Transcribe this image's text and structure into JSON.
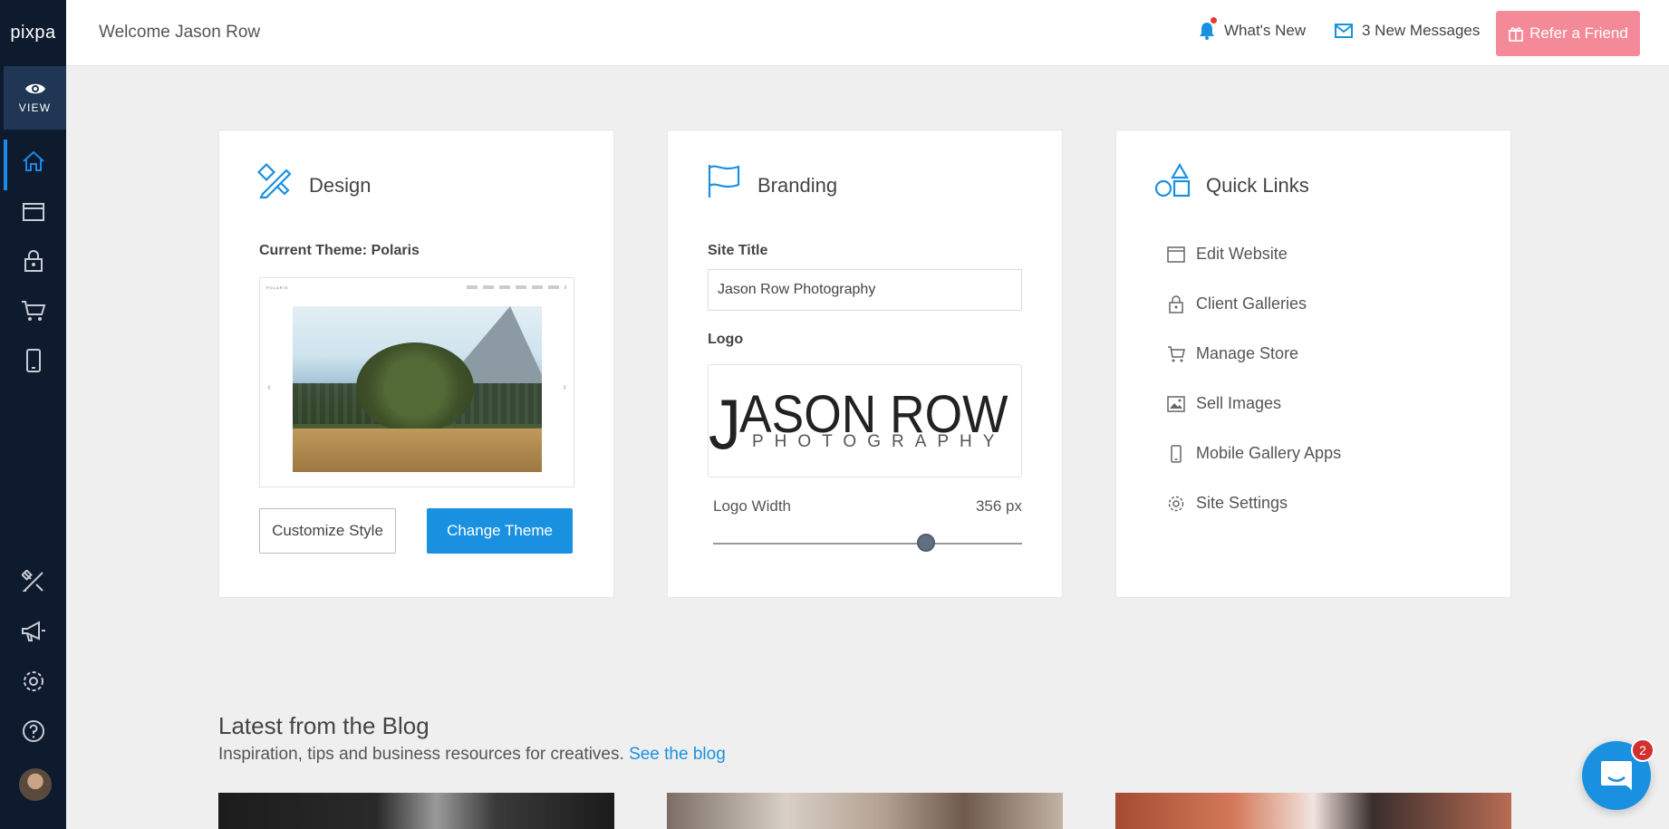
{
  "sidebar": {
    "logo": "pixpa",
    "view_label": "VIEW",
    "top_icons": [
      "home-icon",
      "website-icon",
      "lock-icon",
      "cart-icon",
      "mobile-icon"
    ],
    "bottom_icons": [
      "design-tools-icon",
      "megaphone-icon",
      "gear-icon",
      "help-icon"
    ]
  },
  "header": {
    "welcome": "Welcome Jason Row",
    "whats_new": "What's New",
    "messages": "3 New Messages",
    "refer": "Refer a Friend"
  },
  "design": {
    "title": "Design",
    "current_theme": "Current Theme: Polaris",
    "preview_brand": "POLARIS",
    "customize_label": "Customize Style",
    "change_label": "Change Theme"
  },
  "branding": {
    "title": "Branding",
    "site_title_label": "Site Title",
    "site_title_value": "Jason Row Photography",
    "logo_label": "Logo",
    "logo_main": "JASON ROW",
    "logo_sub": "PHOTOGRAPHY",
    "logo_width_label": "Logo Width",
    "logo_width_value": "356 px",
    "logo_width_level": 0.69
  },
  "quick_links": {
    "title": "Quick Links",
    "items": [
      {
        "label": "Edit Website",
        "icon": "browser-icon"
      },
      {
        "label": "Client Galleries",
        "icon": "lock-icon"
      },
      {
        "label": "Manage Store",
        "icon": "cart-icon"
      },
      {
        "label": "Sell Images",
        "icon": "image-icon"
      },
      {
        "label": "Mobile Gallery Apps",
        "icon": "mobile-icon"
      },
      {
        "label": "Site Settings",
        "icon": "gear-icon"
      }
    ]
  },
  "blog": {
    "title": "Latest from the Blog",
    "subtitle": "Inspiration, tips and business resources for creatives.",
    "link": "See the blog"
  },
  "chat": {
    "badge": "2"
  },
  "colors": {
    "sidebar": "#0e1a2e",
    "accent": "#1a91e0",
    "refer": "#f48a98"
  }
}
